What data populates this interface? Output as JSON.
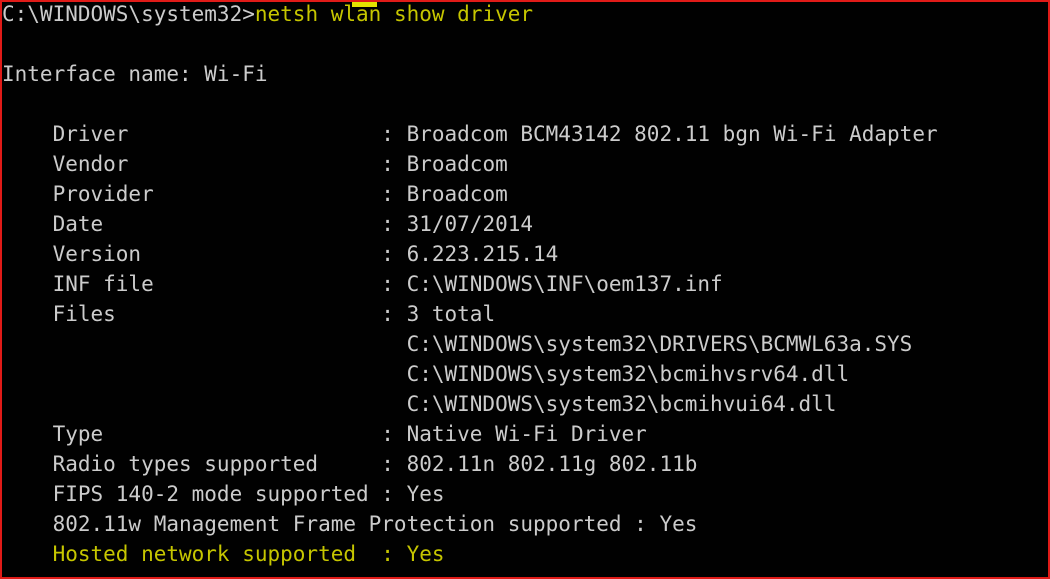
{
  "window": {
    "kind": "windows-command-prompt",
    "border_color": "#e01b18",
    "background_color": "#010101",
    "text_color": "#cccccc",
    "highlight_color": "#c6c600"
  },
  "prompt_line": {
    "prompt": "C:\\WINDOWS\\system32>",
    "command": "netsh wlan show driver"
  },
  "interface": {
    "line": "Interface name: Wi-Fi",
    "label": "Interface name",
    "value": "Wi-Fi"
  },
  "properties": [
    {
      "label": "Driver",
      "separator": ":",
      "value": "Broadcom BCM43142 802.11 bgn Wi-Fi Adapter",
      "highlight": false
    },
    {
      "label": "Vendor",
      "separator": ":",
      "value": "Broadcom",
      "highlight": false
    },
    {
      "label": "Provider",
      "separator": ":",
      "value": "Broadcom",
      "highlight": false
    },
    {
      "label": "Date",
      "separator": ":",
      "value": "31/07/2014",
      "highlight": false
    },
    {
      "label": "Version",
      "separator": ":",
      "value": "6.223.215.14",
      "highlight": false
    },
    {
      "label": "INF file",
      "separator": ":",
      "value": "C:\\WINDOWS\\INF\\oem137.inf",
      "highlight": false
    },
    {
      "label": "Files",
      "separator": ":",
      "value": "3 total",
      "highlight": false
    }
  ],
  "files": [
    "C:\\WINDOWS\\system32\\DRIVERS\\BCMWL63a.SYS",
    "C:\\WINDOWS\\system32\\bcmihvsrv64.dll",
    "C:\\WINDOWS\\system32\\bcmihvui64.dll"
  ],
  "properties_tail": [
    {
      "label": "Type",
      "separator": ":",
      "value": "Native Wi-Fi Driver",
      "highlight": false
    },
    {
      "label": "Radio types supported",
      "separator": ":",
      "value": "802.11n 802.11g 802.11b",
      "highlight": false
    }
  ],
  "long_lines": [
    {
      "text": "FIPS 140-2 mode supported : Yes",
      "highlight": false
    },
    {
      "text": "802.11w Management Frame Protection supported : Yes",
      "highlight": false
    },
    {
      "text": "Hosted network supported  : Yes",
      "highlight": true
    }
  ],
  "layout": {
    "indent": "    ",
    "label_width_chars": 26
  }
}
